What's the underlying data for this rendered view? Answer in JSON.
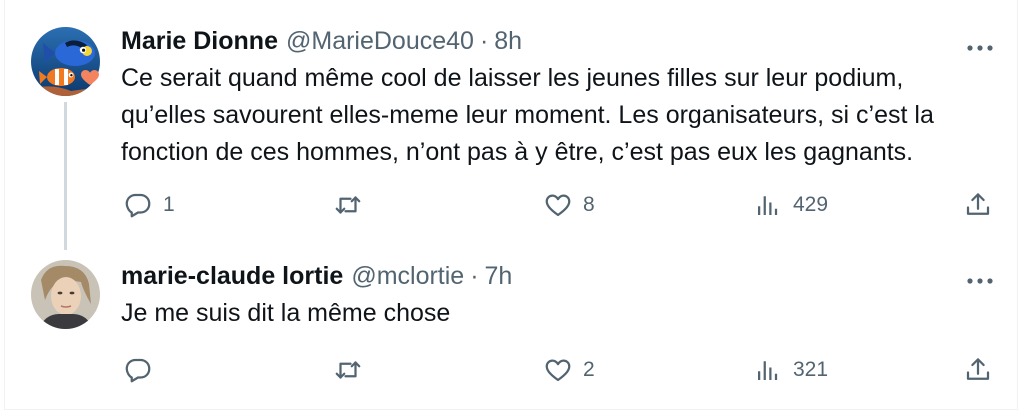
{
  "tweets": [
    {
      "display_name": "Marie Dionne",
      "handle": "@MarieDouce40",
      "separator": "·",
      "time": "8h",
      "text_lines": [
        "Ce serait quand même cool de laisser les jeunes filles sur leur podium,",
        "qu’elles savourent elles-meme leur moment. Les organisateurs, si c’est la",
        "fonction de ces hommes, n’ont pas à y être, c’est pas eux les gagnants."
      ],
      "replies": "1",
      "reposts": "",
      "likes": "8",
      "views": "429",
      "avatar_icon": "finding-nemo-fish-avatar",
      "badge_icon": "orange-heart-icon"
    },
    {
      "display_name": "marie-claude lortie",
      "handle": "@mclortie",
      "separator": "·",
      "time": "7h",
      "text_lines": [
        "Je me suis dit la même chose"
      ],
      "replies": "",
      "reposts": "",
      "likes": "2",
      "views": "321",
      "avatar_icon": "person-photo-avatar"
    }
  ],
  "colors": {
    "text_primary": "#0f1419",
    "text_secondary": "#536471",
    "thread_line": "#cfd9de",
    "heart_badge": "#f4845f",
    "border": "#eff3f4"
  },
  "icons": [
    "reply-icon",
    "repost-icon",
    "like-icon",
    "views-icon",
    "share-icon",
    "more-options-icon"
  ]
}
